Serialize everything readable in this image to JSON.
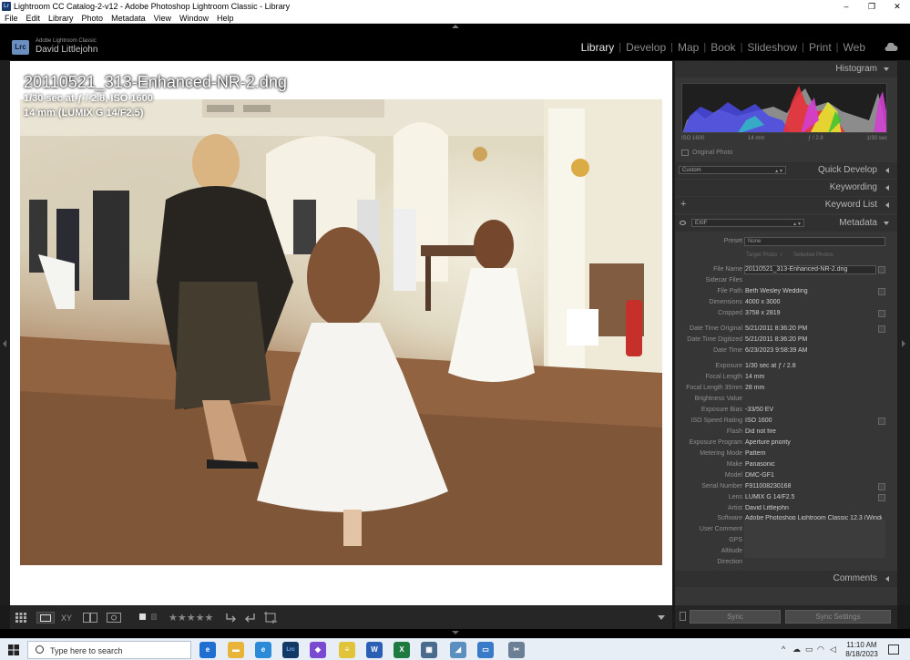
{
  "window": {
    "title": "Lightroom CC Catalog-2-v12 - Adobe Photoshop Lightroom Classic - Library",
    "app_icon_text": "Lr",
    "controls": [
      "–",
      "❐",
      "✕"
    ]
  },
  "menubar": [
    "File",
    "Edit",
    "Library",
    "Photo",
    "Metadata",
    "View",
    "Window",
    "Help"
  ],
  "identity": {
    "logo": "Lrc",
    "product": "Adobe Lightroom Classic",
    "user": "David Littlejohn"
  },
  "modules": [
    {
      "label": "Library",
      "active": true
    },
    {
      "label": "Develop",
      "active": false
    },
    {
      "label": "Map",
      "active": false
    },
    {
      "label": "Book",
      "active": false
    },
    {
      "label": "Slideshow",
      "active": false
    },
    {
      "label": "Print",
      "active": false
    },
    {
      "label": "Web",
      "active": false
    }
  ],
  "overlay": {
    "filename": "20110521_313-Enhanced-NR-2.dng",
    "exposure_line": "1/30 sec at ƒ / 2.8, ISO 1600",
    "lens_line": "14 mm (LUMIX G 14/F2.5)"
  },
  "panels": {
    "histogram": {
      "title": "Histogram",
      "info": [
        "ISO 1600",
        "14 mm",
        "ƒ / 2.8",
        "1/30 sec"
      ],
      "original_photo": "Original Photo"
    },
    "quick_develop": {
      "title": "Quick Develop",
      "preset_select": "Custom"
    },
    "keywording": {
      "title": "Keywording"
    },
    "keyword_list": {
      "title": "Keyword List",
      "plus": "+"
    },
    "metadata": {
      "title": "Metadata",
      "view_select": "EXIF",
      "preset_label": "Preset",
      "preset_value": "None",
      "target_photo": "Target Photo",
      "divider": "/",
      "selected_photos": "Selected Photos"
    },
    "comments": {
      "title": "Comments"
    }
  },
  "metadata_rows": [
    {
      "k": "File Name",
      "v": "20110521_313-Enhanced-NR-2.dng",
      "btn": true
    },
    {
      "k": "Sidecar Files",
      "v": "",
      "btn": false
    },
    {
      "k": "File Path",
      "v": "Beth Wesley Wedding",
      "btn": true
    },
    {
      "k": "Dimensions",
      "v": "4000 x 3000",
      "btn": false
    },
    {
      "k": "Cropped",
      "v": "3758 x 2819",
      "btn": true
    },
    {
      "k": "Date Time Original",
      "v": "5/21/2011 8:36:20 PM",
      "btn": true
    },
    {
      "k": "Date Time Digitized",
      "v": "5/21/2011 8:36:20 PM",
      "btn": false
    },
    {
      "k": "Date Time",
      "v": "6/23/2023 9:58:39 AM",
      "btn": false
    },
    {
      "k": "Exposure",
      "v": "1/30 sec at ƒ / 2.8",
      "btn": false
    },
    {
      "k": "Focal Length",
      "v": "14 mm",
      "btn": false
    },
    {
      "k": "Focal Length 35mm",
      "v": "28 mm",
      "btn": false
    },
    {
      "k": "Brightness Value",
      "v": "",
      "btn": false
    },
    {
      "k": "Exposure Bias",
      "v": "-33/50 EV",
      "btn": false
    },
    {
      "k": "ISO Speed Rating",
      "v": "ISO 1600",
      "btn": true
    },
    {
      "k": "Flash",
      "v": "Did not fire",
      "btn": false
    },
    {
      "k": "Exposure Program",
      "v": "Aperture priority",
      "btn": false
    },
    {
      "k": "Metering Mode",
      "v": "Pattern",
      "btn": false
    },
    {
      "k": "Make",
      "v": "Panasonic",
      "btn": false
    },
    {
      "k": "Model",
      "v": "DMC-GF1",
      "btn": false
    },
    {
      "k": "Serial Number",
      "v": "F911008230168",
      "btn": true
    },
    {
      "k": "Lens",
      "v": "LUMIX G 14/F2.5",
      "btn": true
    },
    {
      "k": "Artist",
      "v": "David Littlejohn",
      "btn": false
    },
    {
      "k": "Software",
      "v": "Adobe Photoshop Lightroom Classic 12.3 (Windo...",
      "btn": false
    },
    {
      "k": "User Comment",
      "v": "",
      "btn": false
    },
    {
      "k": "GPS",
      "v": "",
      "btn": true
    },
    {
      "k": "Altitude",
      "v": "",
      "btn": true
    },
    {
      "k": "Direction",
      "v": "",
      "btn": false
    }
  ],
  "toolbar": {
    "stars": "★★★★★",
    "sync_label": "Sync",
    "sync_settings_label": "Sync Settings"
  },
  "taskbar": {
    "search_placeholder": "Type here to search",
    "apps": [
      {
        "name": "edge-legacy",
        "text": "e",
        "color": "#1f6fd1"
      },
      {
        "name": "file-explorer",
        "text": "▬",
        "color": "#e8b53a"
      },
      {
        "name": "edge",
        "text": "e",
        "color": "#2b8bd8"
      },
      {
        "name": "lightroom",
        "text": "Lrc",
        "color": "#123a66"
      },
      {
        "name": "visual-studio",
        "text": "◆",
        "color": "#7a4bd1"
      },
      {
        "name": "sticky-notes",
        "text": "≡",
        "color": "#e1c43a"
      },
      {
        "name": "word",
        "text": "W",
        "color": "#2b5fb5"
      },
      {
        "name": "excel",
        "text": "X",
        "color": "#1f7a42"
      },
      {
        "name": "calculator",
        "text": "▦",
        "color": "#4a6b8e"
      },
      {
        "name": "paint",
        "text": "◢",
        "color": "#5a8fbf"
      },
      {
        "name": "window-app",
        "text": "▭",
        "color": "#3a7bc8"
      },
      {
        "name": "snipping-tool",
        "text": "✂",
        "color": "#6b7f95"
      }
    ],
    "time": "11:10 AM",
    "date": "8/18/2023"
  },
  "colors": {
    "accent_active": "#e6e6e6",
    "panel_bg": "#363636",
    "header_bg": "#303030"
  }
}
